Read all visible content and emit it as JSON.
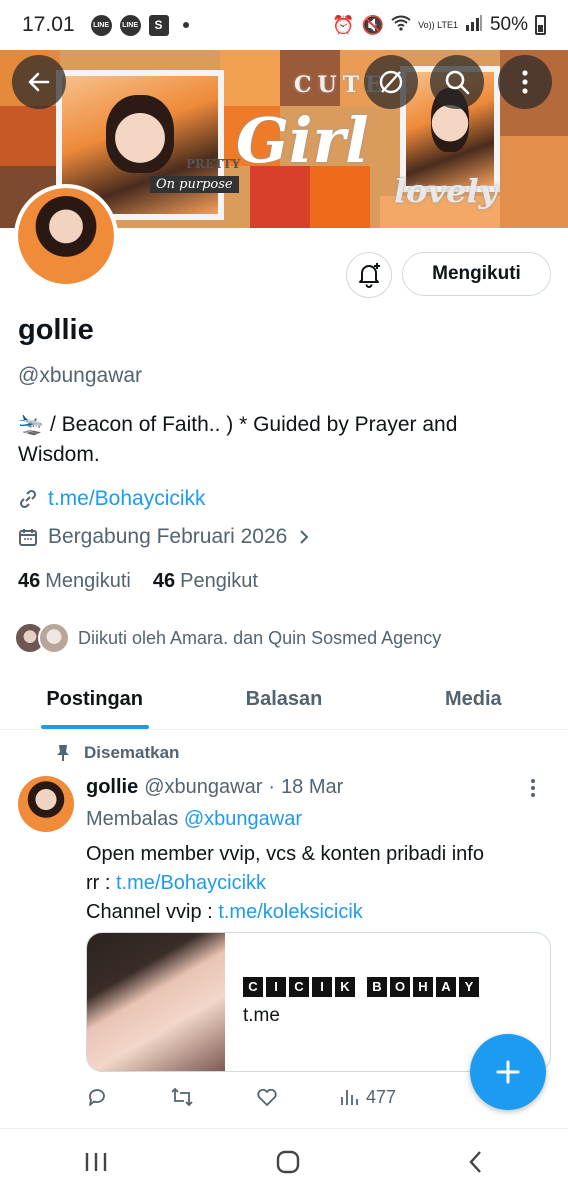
{
  "status_bar": {
    "time": "17.01",
    "notif_icons": [
      "LINE",
      "LINE"
    ],
    "shop_icon": "S",
    "network": "Vo)) LTE1",
    "battery": "50%"
  },
  "banner": {
    "word_girl": "Girl",
    "word_cute": "CUTE",
    "word_lovely": "lovely",
    "caption_on_purpose": "On purpose",
    "caption_pretty": "PRETTY"
  },
  "header_buttons": {
    "back": "back-arrow-icon",
    "grok": "grok-icon",
    "search": "search-icon",
    "more": "more-vertical-icon"
  },
  "profile": {
    "display_name": "gollie",
    "handle": "@xbungawar",
    "bio_emoji": "🛬",
    "bio_text": "/ Beacon of Faith.. ) * Guided by Prayer and Wisdom.",
    "link": "t.me/Bohaycicikk",
    "joined": "Bergabung Februari 2026",
    "following_count": "46",
    "following_label": "Mengikuti",
    "followers_count": "46",
    "followers_label": "Pengikut",
    "followed_by": "Diikuti oleh Amara. dan Quin Sosmed Agency",
    "follow_button": "Mengikuti"
  },
  "tabs": [
    {
      "label": "Postingan",
      "active": true
    },
    {
      "label": "Balasan",
      "active": false
    },
    {
      "label": "Media",
      "active": false
    }
  ],
  "post": {
    "pinned_label": "Disematkan",
    "author_name": "gollie",
    "author_handle": "@xbungawar",
    "sep": "·",
    "date": "18 Mar",
    "reply_prefix": "Membalas",
    "reply_handle": "@xbungawar",
    "line1": "Open member vvip, vcs & konten pribadi info",
    "line2_prefix": "rr :",
    "line2_link": "t.me/Bohaycicikk",
    "line3_prefix": "Channel vvip :",
    "line3_link": "t.me/koleksicicik",
    "card_title_word1": [
      "C",
      "I",
      "C",
      "I",
      "K"
    ],
    "card_title_word2": [
      "B",
      "O",
      "H",
      "A",
      "Y"
    ],
    "card_domain": "t.me",
    "views": "477"
  },
  "colors": {
    "accent": "#1d9bf0",
    "text": "#0f1419",
    "muted": "#536471"
  }
}
